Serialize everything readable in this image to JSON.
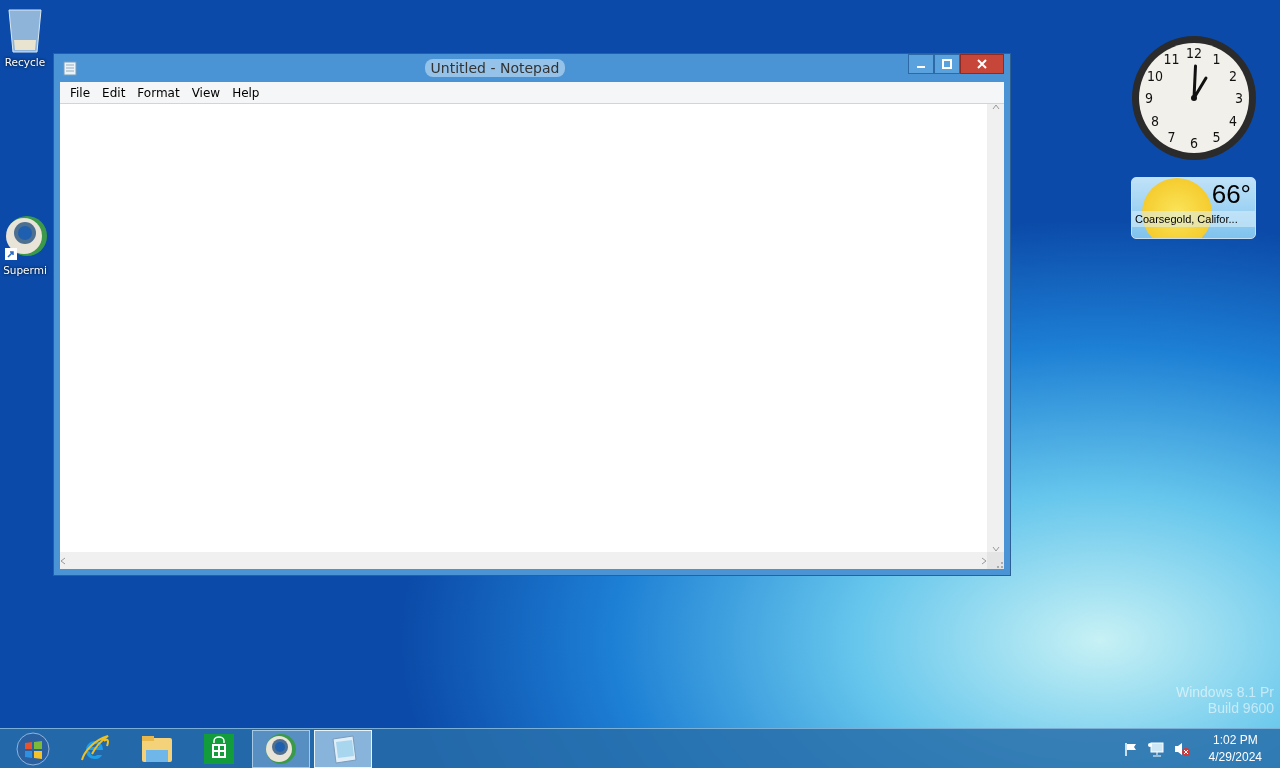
{
  "desktop_icons": [
    {
      "kind": "recycle-bin",
      "label": "Recycle"
    },
    {
      "kind": "globe-shortcut",
      "label": "Supermi"
    }
  ],
  "window": {
    "title": "Untitled - Notepad",
    "menu": [
      "File",
      "Edit",
      "Format",
      "View",
      "Help"
    ]
  },
  "clock_gadget": {
    "numbers": [
      "11",
      "12",
      "1",
      "10",
      "2",
      "9",
      "3",
      "8",
      "4",
      "7",
      "6",
      "5"
    ]
  },
  "weather_gadget": {
    "temperature": "66°",
    "location": "Coarsegold, Califor..."
  },
  "watermark": [
    "Windows 8.1 Pr",
    "Build 9600"
  ],
  "taskbar": {
    "items": [
      {
        "kind": "start",
        "running": false,
        "selected": false
      },
      {
        "kind": "browser",
        "running": false,
        "selected": false
      },
      {
        "kind": "folder",
        "running": false,
        "selected": false
      },
      {
        "kind": "store",
        "running": false,
        "selected": false
      },
      {
        "kind": "globe",
        "running": true,
        "selected": false
      },
      {
        "kind": "notepad",
        "running": true,
        "selected": true
      }
    ],
    "tray": {
      "time": "1:02 PM",
      "date": "4/29/2024"
    }
  }
}
